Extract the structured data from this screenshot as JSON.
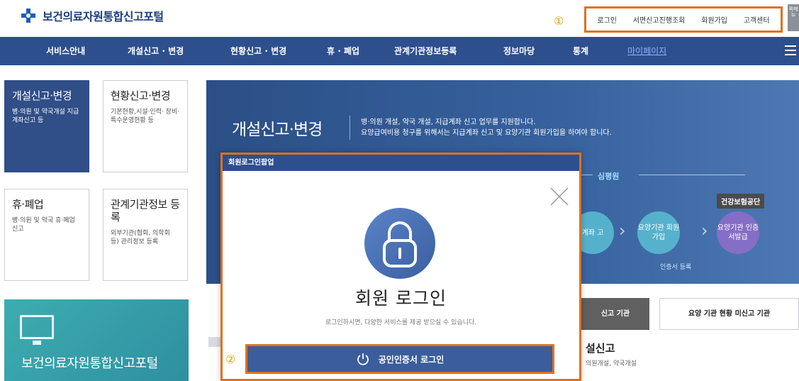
{
  "brand": {
    "name": "보건의료자원통합신고포털"
  },
  "util_links": [
    "로그인",
    "서면신고진행조회",
    "회원가입",
    "고객센터"
  ],
  "side_tab": "퀵메뉴",
  "markers": {
    "one": "①",
    "two": "②"
  },
  "nav": {
    "items": [
      "서비스안내",
      "개설신고 · 변경",
      "현황신고 · 변경",
      "휴 · 폐업",
      "관계기관정보등록",
      "정보마당",
      "통계",
      "마이페이지"
    ]
  },
  "cards": [
    {
      "title": "개설신고·변경",
      "desc": "병·의원 및 약국개설 지급계좌신고 등"
    },
    {
      "title": "현황신고·변경",
      "desc": "기본현황,시설·인력· 장비·특수운영현황 등"
    },
    {
      "title": "휴·폐업",
      "desc": "병·의원 및 약국 휴·폐업 신고"
    },
    {
      "title": "관계기관정보 등록",
      "desc": "외부기관(협회, 의학회 등) 관리정보 등록"
    }
  ],
  "promo": {
    "text": "보건의료자원통합신고포털"
  },
  "banner": {
    "title": "개설신고·변경",
    "desc_line1": "병·의원 개설, 약국 개설, 지급계좌 신고 업무를 지원합니다.",
    "desc_line2": "요양급여비용 청구를 위해서는 지급계좌 신고 및 요양기관 회원가입을 하여야 합니다.",
    "flow_label": "심평원",
    "steps": [
      "계좌 고",
      "요양기관 회원가입",
      "요양기관 인증서발급"
    ],
    "health_badge": "건강보험공단",
    "cert_register": "인증서 등록"
  },
  "tabs": [
    "신고 기관",
    "요양 기관 현황 미신고 기관"
  ],
  "section": {
    "title": "설신고",
    "sub": "의원개설, 약국개설"
  },
  "popup": {
    "header": "회원로그인팝업",
    "title": "회원 로그인",
    "subtitle": "로그인하시면, 다양한 서비스를 제공 받으실 수 있습니다.",
    "cert_button": "공인인증서 로그인"
  },
  "colors": {
    "nav": "#2e4f8e",
    "highlight": "#e2711d",
    "button": "#3b5d9c"
  }
}
